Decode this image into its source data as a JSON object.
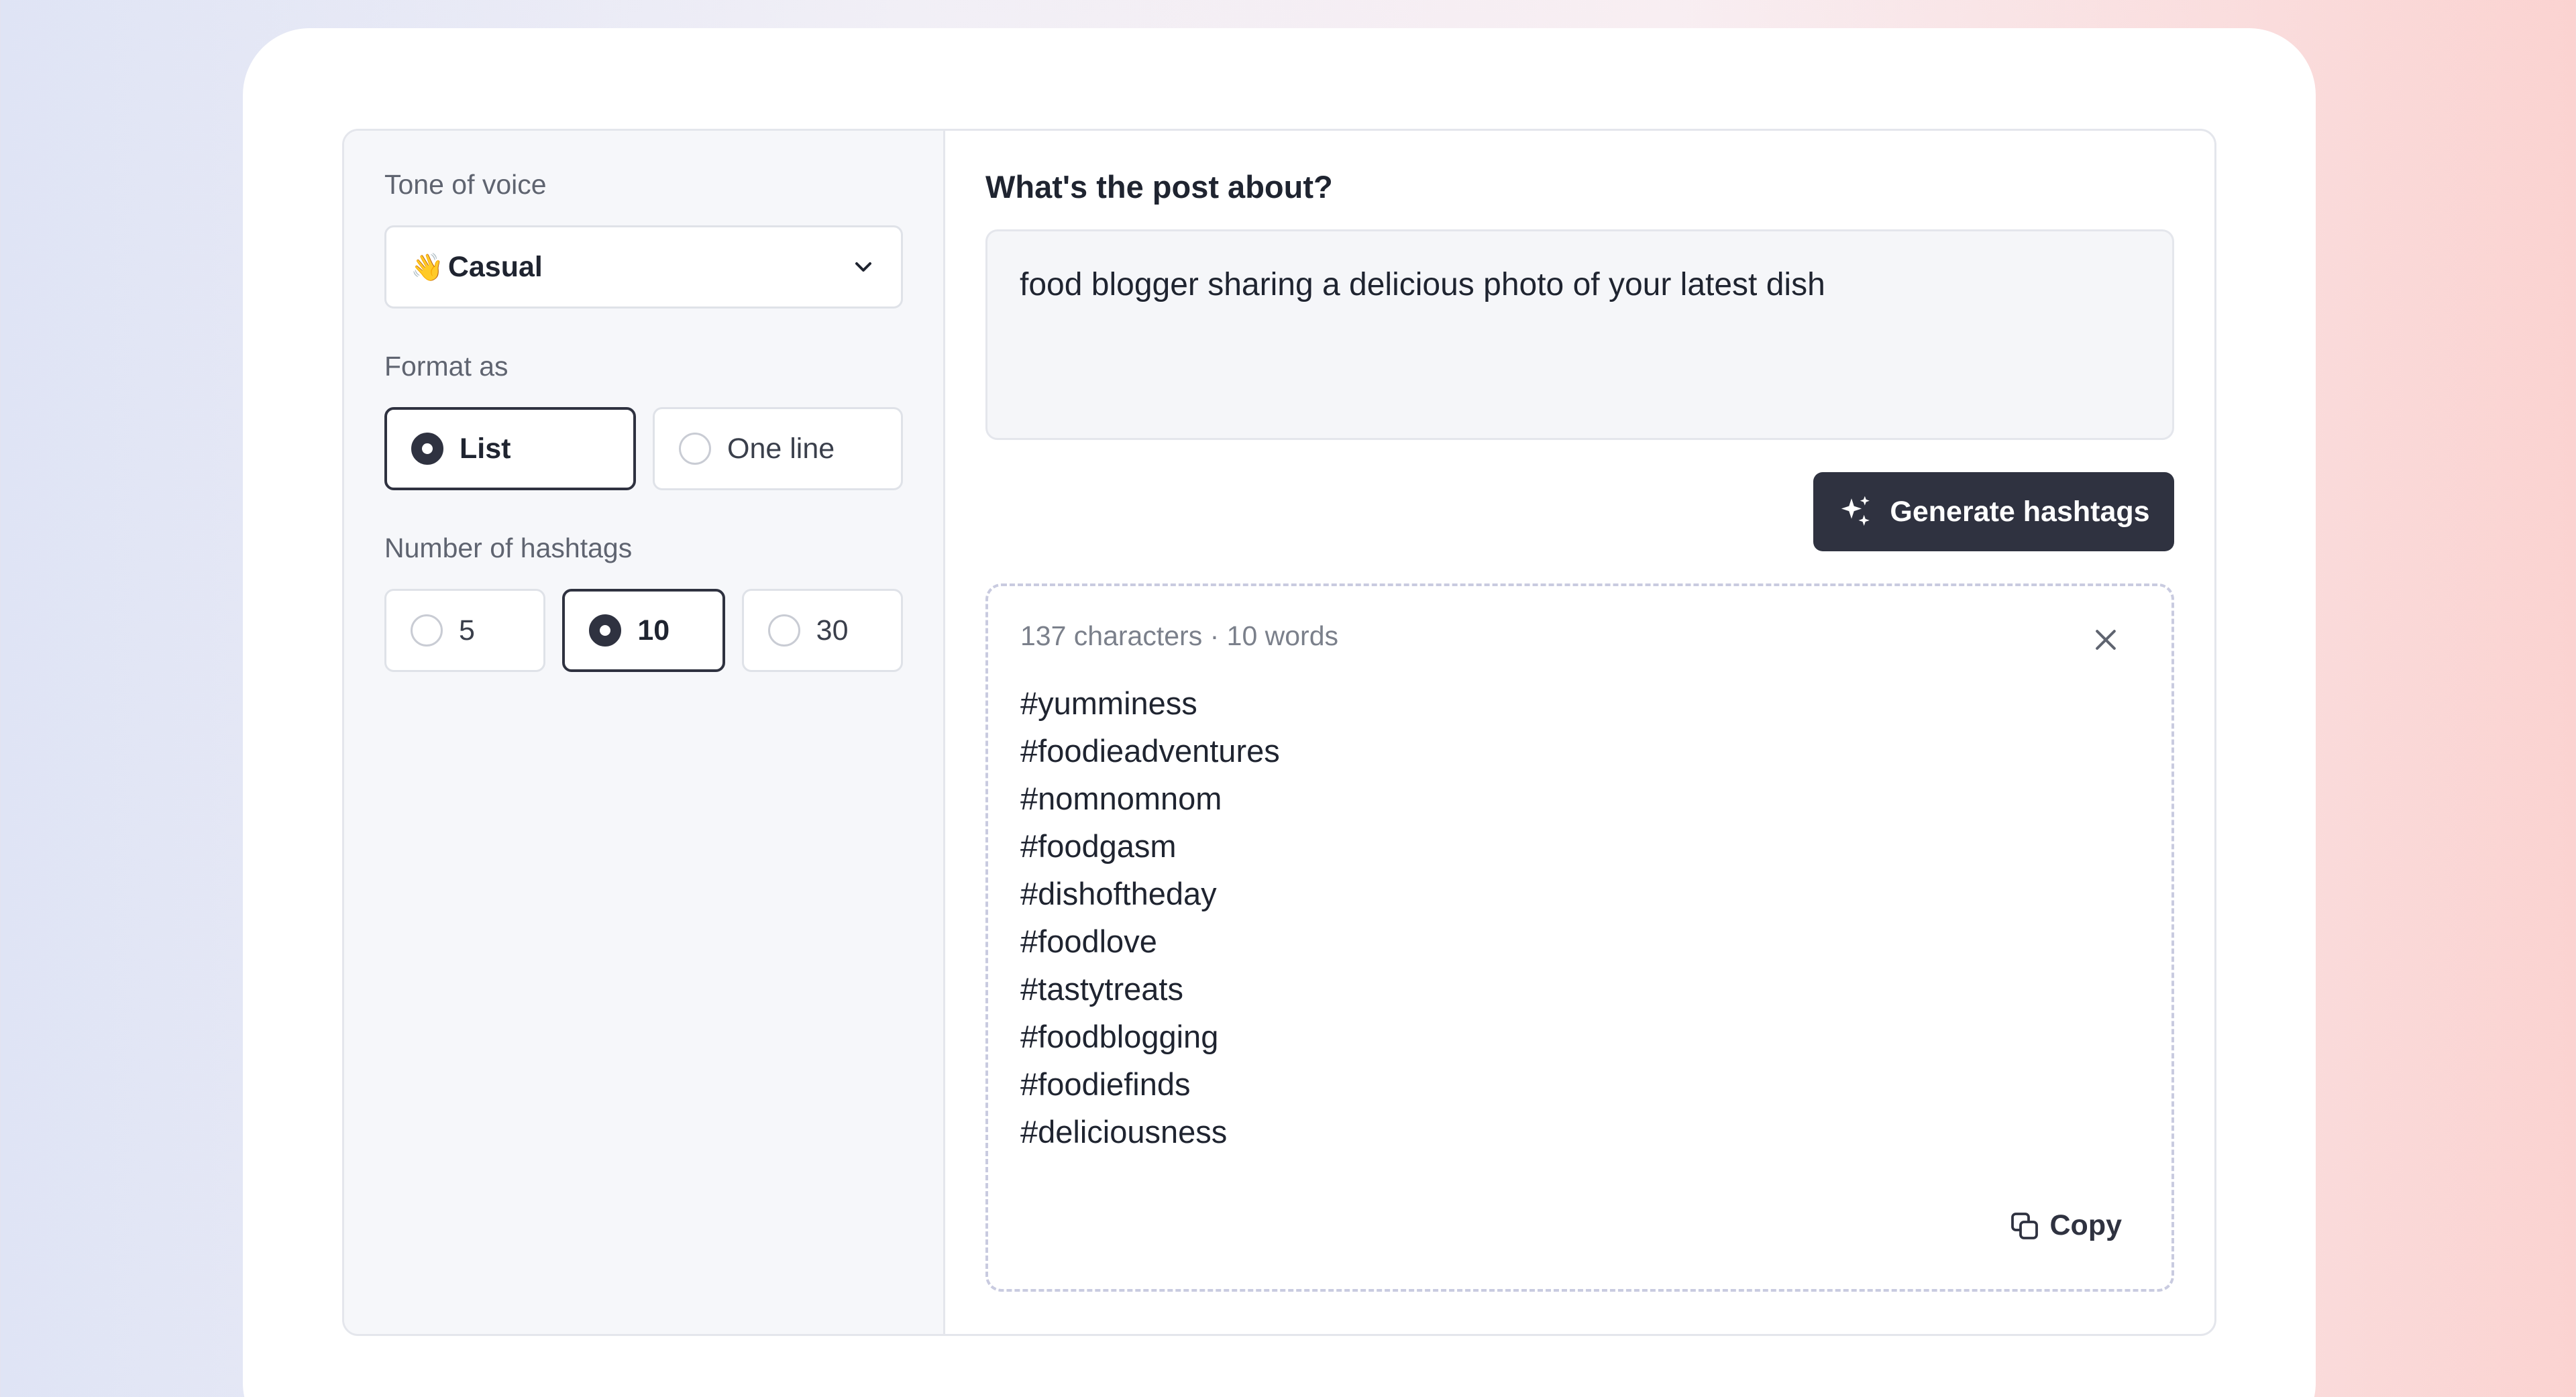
{
  "settings": {
    "tone_label": "Tone of voice",
    "tone_value": "Casual",
    "tone_emoji": "👋",
    "format_label": "Format as",
    "format_options": [
      "List",
      "One line"
    ],
    "format_selected": "List",
    "count_label": "Number of hashtags",
    "count_options": [
      "5",
      "10",
      "30"
    ],
    "count_selected": "10"
  },
  "prompt": {
    "title": "What's the post about?",
    "value": "food blogger sharing a delicious photo of your latest dish"
  },
  "actions": {
    "generate_label": "Generate hashtags",
    "copy_label": "Copy"
  },
  "result": {
    "meta": "137 characters · 10 words",
    "hashtags": [
      "#yumminess",
      "#foodieadventures",
      "#nomnomnom",
      "#foodgasm",
      "#dishoftheday",
      "#foodlove",
      "#tastytreats",
      "#foodblogging",
      "#foodiefinds",
      "#deliciousness"
    ]
  },
  "icons": {
    "select": "chevron-down-icon",
    "generate": "sparkles-icon",
    "close": "close-icon",
    "copy": "copy-icon"
  },
  "colors": {
    "primary": "#2f3240",
    "panel_bg": "#f6f7fa",
    "border": "#e4e6ec",
    "dashed_border": "#c9cbe0"
  }
}
